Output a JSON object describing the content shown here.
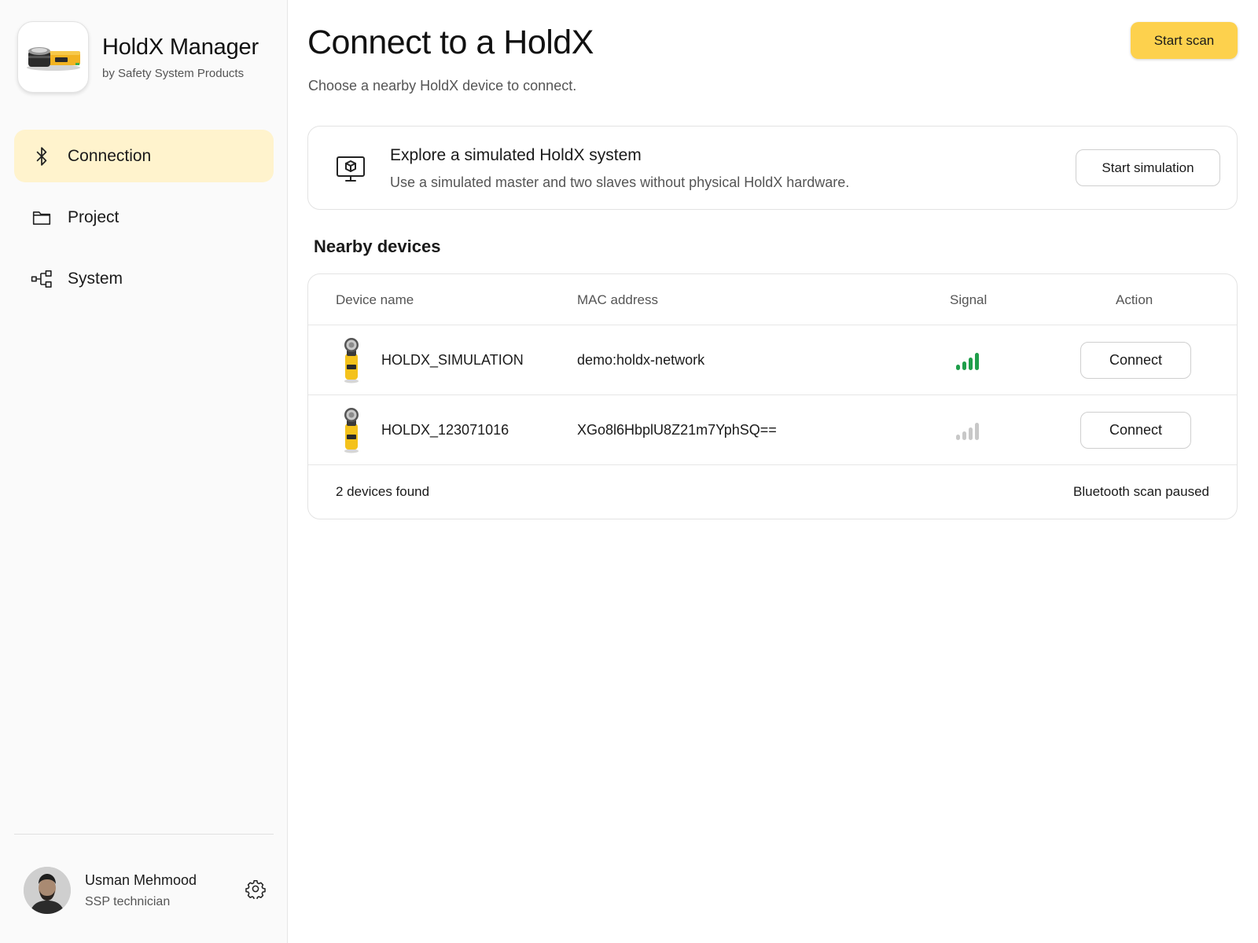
{
  "app": {
    "title": "HoldX Manager",
    "subtitle": "by Safety System Products",
    "logo_icon": "holdx-device-logo"
  },
  "sidebar": {
    "items": [
      {
        "label": "Connection",
        "icon": "bluetooth-icon",
        "active": true
      },
      {
        "label": "Project",
        "icon": "folder-icon",
        "active": false
      },
      {
        "label": "System",
        "icon": "hierarchy-icon",
        "active": false
      }
    ]
  },
  "user": {
    "name": "Usman Mehmood",
    "role": "SSP technician",
    "settings_icon": "gear-icon"
  },
  "header": {
    "title": "Connect to a HoldX",
    "subtitle": "Choose a nearby HoldX device to connect.",
    "start_scan_label": "Start scan"
  },
  "simulation": {
    "icon": "monitor-cube-icon",
    "title": "Explore a simulated HoldX system",
    "description": "Use a simulated master and two slaves without physical HoldX hardware.",
    "button_label": "Start simulation"
  },
  "devices": {
    "section_title": "Nearby devices",
    "columns": [
      "Device name",
      "MAC address",
      "Signal",
      "Action"
    ],
    "rows": [
      {
        "name": "HOLDX_SIMULATION",
        "mac": "demo:holdx-network",
        "signal": 4,
        "action": "Connect"
      },
      {
        "name": "HOLDX_123071016",
        "mac": "XGo8l6HbplU8Z21m7YphSQ==",
        "signal": 0,
        "action": "Connect"
      }
    ],
    "footer_count": "2 devices found",
    "footer_status": "Bluetooth scan paused"
  },
  "colors": {
    "accent": "#fdd14d",
    "active_nav": "#fff3cd",
    "signal_strong": "#1e9e4a",
    "signal_weak": "#c8c8c8"
  }
}
